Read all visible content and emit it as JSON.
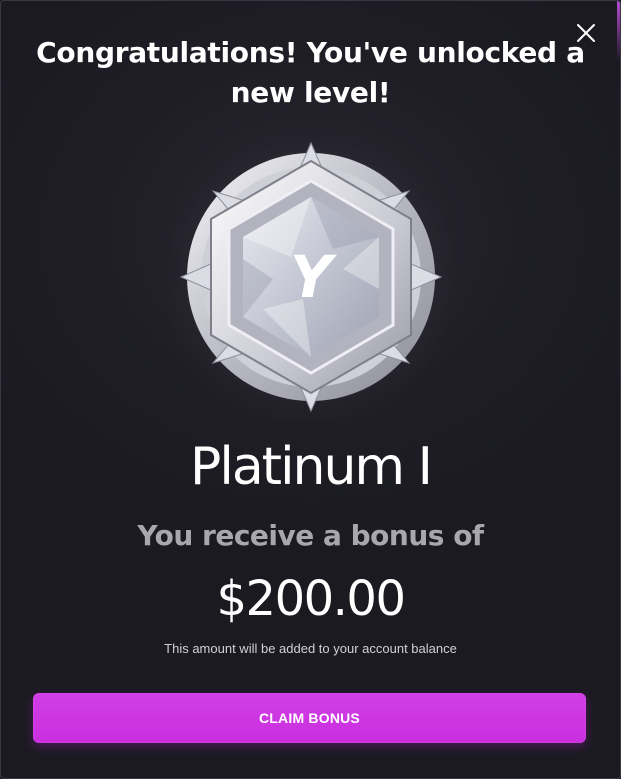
{
  "modal": {
    "title": "Congratulations! You've unlocked a new level!",
    "close_icon": "close-icon",
    "badge_icon": "platinum-level-badge-icon",
    "badge_emblem_text": "Y",
    "level_name": "Platinum I",
    "bonus_label": "You receive a bonus of",
    "bonus_amount": "$200.00",
    "note": "This amount will be added to your account balance",
    "claim_button_label": "CLAIM BONUS"
  },
  "colors": {
    "background": "#1f1e26",
    "accent": "#cc35e0",
    "muted_text": "#a9a7ae"
  }
}
